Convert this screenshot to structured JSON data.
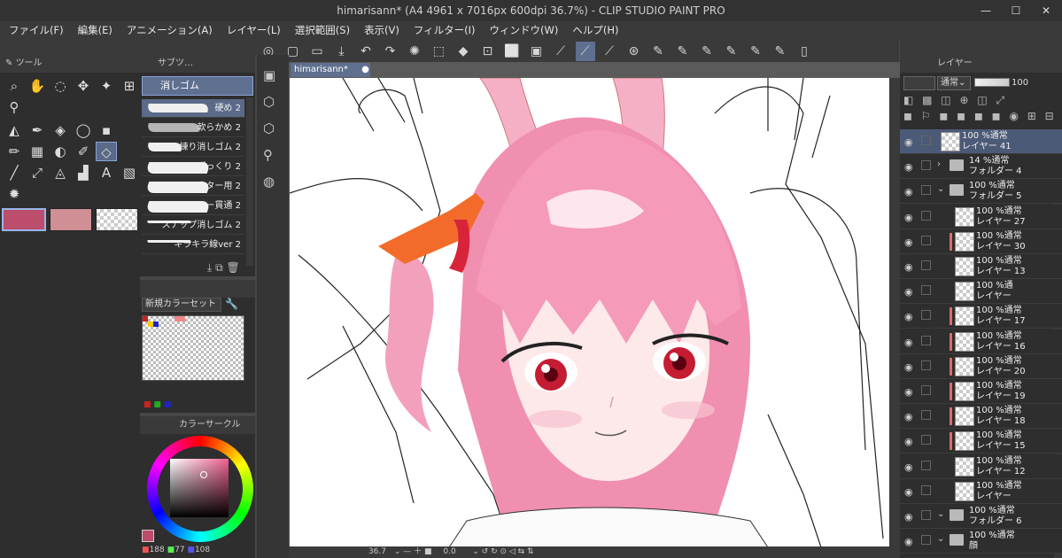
{
  "window": {
    "title": "himarisann* (A4 4961 x 7016px 600dpi 36.7%)  - CLIP STUDIO PAINT PRO",
    "minimize": "—",
    "maximize": "☐",
    "close": "✕"
  },
  "menu": [
    "ファイル(F)",
    "編集(E)",
    "アニメーション(A)",
    "レイヤー(L)",
    "選択範囲(S)",
    "表示(V)",
    "フィルター(I)",
    "ウィンドウ(W)",
    "ヘルプ(H)"
  ],
  "tool_panel": {
    "title": "ツール"
  },
  "sub_tool": {
    "tab_label": "サブツ…",
    "group_label": "消しゴム",
    "brushes": [
      "硬め",
      "軟らかめ",
      "練り消しゴム",
      "ざっくり",
      "ベクター用",
      "レイヤー貫通",
      "スナップ消しゴム",
      "キラキラ線ver"
    ],
    "brush_size": "2"
  },
  "color_set": {
    "name": "新規カラーセット"
  },
  "color_circle": {
    "title": "カラーサークル",
    "r": "188",
    "g": "77",
    "b": "108"
  },
  "colors": {
    "main": "#bc4d6c",
    "sub": "#cf8f95",
    "accent": "#5e6f8f"
  },
  "document": {
    "tab": "himarisann*"
  },
  "statusbar": {
    "zoom": "36.7",
    "angle": "0.0"
  },
  "layer_panel": {
    "title": "レイヤー",
    "blend_mode": "通常",
    "opacity": "100",
    "layers": [
      {
        "line1": "100 %通常",
        "line2": "レイヤー 41",
        "kind": "layer",
        "selected": true
      },
      {
        "line1": "14 %通常",
        "line2": "フォルダー 4",
        "kind": "folder"
      },
      {
        "line1": "100 %通常",
        "line2": "フォルダー 5",
        "kind": "folder-open"
      },
      {
        "line1": "100 %通常",
        "line2": "レイヤー 27",
        "kind": "layer"
      },
      {
        "line1": "100 %通常",
        "line2": "レイヤー 30",
        "kind": "layer",
        "clip": true
      },
      {
        "line1": "100 %通常",
        "line2": "レイヤー 13",
        "kind": "layer"
      },
      {
        "line1": "100 %通",
        "line2": "レイヤー",
        "kind": "layer"
      },
      {
        "line1": "100 %通常",
        "line2": "レイヤー 17",
        "kind": "layer",
        "clip": true
      },
      {
        "line1": "100 %通常",
        "line2": "レイヤー 16",
        "kind": "layer",
        "clip": true
      },
      {
        "line1": "100 %通常",
        "line2": "レイヤー 20",
        "kind": "layer",
        "clip": true
      },
      {
        "line1": "100 %通常",
        "line2": "レイヤー 19",
        "kind": "layer",
        "clip": true
      },
      {
        "line1": "100 %通常",
        "line2": "レイヤー 18",
        "kind": "layer",
        "clip": true
      },
      {
        "line1": "100 %通常",
        "line2": "レイヤー 15",
        "kind": "layer",
        "clip": true
      },
      {
        "line1": "100 %通常",
        "line2": "レイヤー 12",
        "kind": "layer"
      },
      {
        "line1": "100 %通常",
        "line2": "レイヤー",
        "kind": "layer"
      },
      {
        "line1": "100 %通常",
        "line2": "フォルダー 6",
        "kind": "folder-open"
      },
      {
        "line1": "100 %通常",
        "line2": "顔",
        "kind": "folder-open"
      }
    ]
  }
}
